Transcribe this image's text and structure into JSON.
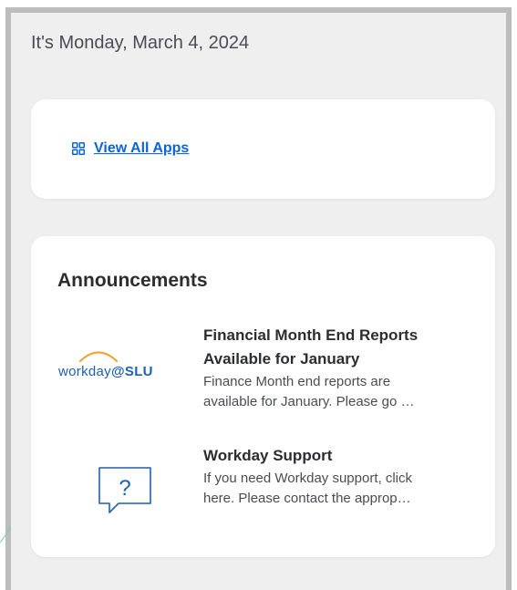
{
  "header": {
    "date": "It's Monday, March 4, 2024"
  },
  "apps_card": {
    "link_label": "View All Apps",
    "icon": "grid-icon"
  },
  "announcements": {
    "title": "Announcements",
    "items": [
      {
        "heading_line1": "Financial Month End Reports",
        "heading_line2": "Available for January",
        "body_line1": "Finance Month end reports are",
        "body_line2": "available for January. Please go …",
        "thumbnail": "workday-slu-logo",
        "logo_text": "workday",
        "logo_suffix": "@SLU"
      },
      {
        "heading_line1": "Workday Support",
        "body_line1": "If you need Workday support, click",
        "body_line2": "here. Please contact the approp…",
        "thumbnail": "question-bubble-icon",
        "icon_glyph": "?"
      }
    ]
  },
  "colors": {
    "link": "#0b64d6",
    "logo_blue": "#1f5fae",
    "logo_orange": "#f2a43a",
    "background": "#efeff0"
  }
}
